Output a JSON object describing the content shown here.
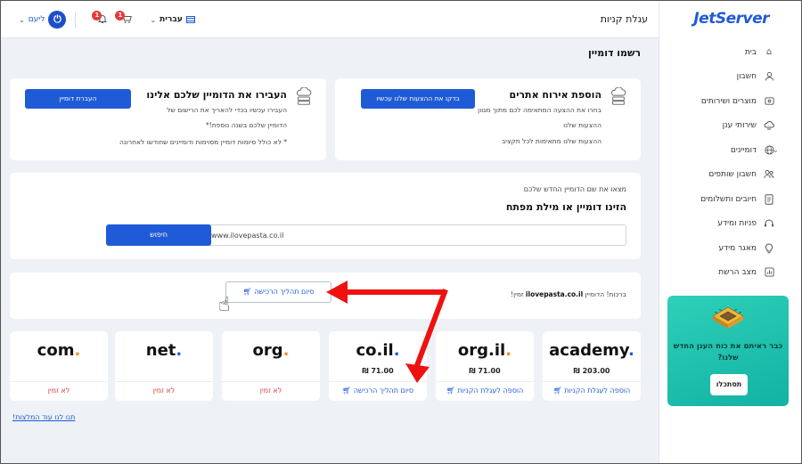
{
  "topbar": {
    "cart_title": "עגלת קניות",
    "user_name": "ליעם",
    "language": "עברית",
    "cart_badge": "1",
    "notif_badge": "1"
  },
  "sidebar": {
    "logo": "JetServer",
    "items": [
      {
        "label": "בית",
        "icon": "home-icon"
      },
      {
        "label": "חשבון",
        "icon": "user-icon"
      },
      {
        "label": "מוצרים ושירותים",
        "icon": "products-icon"
      },
      {
        "label": "שירותי ענן",
        "icon": "cloud-icon"
      },
      {
        "label": "דומיינים",
        "icon": "globe-icon"
      },
      {
        "label": "חשבון שותפים",
        "icon": "partners-icon"
      },
      {
        "label": "חיובים ותשלומים",
        "icon": "billing-icon"
      },
      {
        "label": "פניות ומידע",
        "icon": "headset-icon"
      },
      {
        "label": "מאגר מידע",
        "icon": "lightbulb-icon"
      },
      {
        "label": "מצב הרשת",
        "icon": "network-status-icon"
      }
    ],
    "promo": {
      "text": "כבר ראיתם את כוח הענן החדש שלנו?",
      "button": "תסתכלו"
    }
  },
  "main": {
    "title": "רשמו דומיין",
    "hosting": {
      "title": "הוספת אירוח אתרים",
      "subtitle": "בחרו את ההצעה המתאימה לכם מתוך מגוון",
      "line1": "ההצעות שלנו",
      "line2": "ההצעות שלנו מתאימות לכל תקציב",
      "button": "בדקו את ההצעות שלנו עכשיו"
    },
    "transfer": {
      "title": "העבירו את הדומיין שלכם אלינו",
      "subtitle": "העבירו עכשיו בכדי להאריך את הרישום של",
      "line1": "הדומיין שלכם בשנה נוספת!*",
      "line2": "* לא כולל סיומות דומיין מסוימות ודומיינים שחודשו לאחרונה",
      "button": "העברת דומיין"
    },
    "search": {
      "label": "מצאו את שם הדומיין החדש שלכם",
      "title": "הזינו דומיין או מילת מפתח",
      "value": "www.ilovepasta.co.il",
      "button": "חיפוש"
    },
    "result": {
      "prefix": "ברכות! הדומיין",
      "domain": "ilovepasta.co.il",
      "suffix": "זמין!",
      "checkout": "סיום תהליך הרכישה"
    },
    "tlds": [
      {
        "name": "academy",
        "price": "203.00 ₪",
        "action": "הוספה לעגלת הקניות",
        "available": true,
        "dot_color": "#1f5bd6"
      },
      {
        "name": "org.il",
        "price": "71.00 ₪",
        "action": "הוספה לעגלת הקניות",
        "available": true,
        "dot_color": "#f28c28"
      },
      {
        "name": "co.il",
        "price": "71.00 ₪",
        "action": "סיום תהליך הרכישה",
        "available": true,
        "dot_color": "#1f5bd6"
      },
      {
        "name": "org",
        "price": "",
        "action": "לא זמין",
        "available": false,
        "dot_color": "#f28c28"
      },
      {
        "name": "net",
        "price": "",
        "action": "לא זמין",
        "available": false,
        "dot_color": "#1f5bd6"
      },
      {
        "name": "com",
        "price": "",
        "action": "לא זמין",
        "available": false,
        "dot_color": "#f28c28"
      }
    ],
    "more_link": "תנו לנו עוד המלצות!"
  },
  "colors": {
    "primary": "#1f5bd6",
    "unavailable": "#e23b3b",
    "annotation_arrow": "#ee1111",
    "promo": "#1fc3ae"
  }
}
